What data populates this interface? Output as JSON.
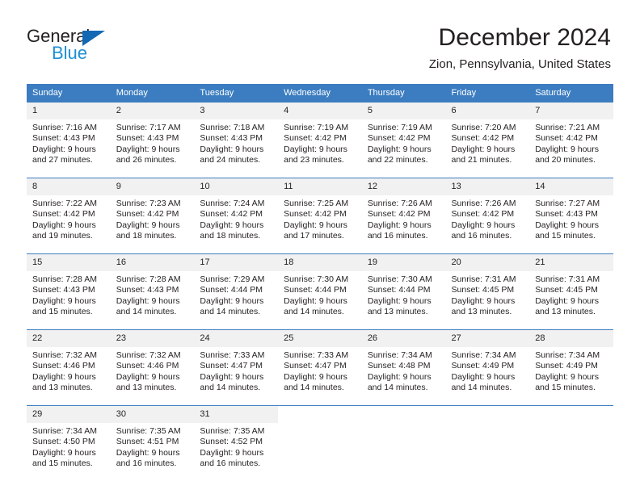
{
  "branding": {
    "name_part1": "General",
    "name_part2": "Blue",
    "color_dark": "#231f20",
    "color_blue": "#1d8fd4",
    "triangle_color": "#1368b3"
  },
  "header": {
    "title": "December 2024",
    "subtitle": "Zion, Pennsylvania, United States",
    "header_bg": "#3b7dc0",
    "header_text_color": "#ffffff",
    "daynum_bg": "#f1f1f1"
  },
  "weekdays": [
    "Sunday",
    "Monday",
    "Tuesday",
    "Wednesday",
    "Thursday",
    "Friday",
    "Saturday"
  ],
  "weeks": [
    [
      {
        "day": "1",
        "lines": [
          "Sunrise: 7:16 AM",
          "Sunset: 4:43 PM",
          "Daylight: 9 hours",
          "and 27 minutes."
        ]
      },
      {
        "day": "2",
        "lines": [
          "Sunrise: 7:17 AM",
          "Sunset: 4:43 PM",
          "Daylight: 9 hours",
          "and 26 minutes."
        ]
      },
      {
        "day": "3",
        "lines": [
          "Sunrise: 7:18 AM",
          "Sunset: 4:43 PM",
          "Daylight: 9 hours",
          "and 24 minutes."
        ]
      },
      {
        "day": "4",
        "lines": [
          "Sunrise: 7:19 AM",
          "Sunset: 4:42 PM",
          "Daylight: 9 hours",
          "and 23 minutes."
        ]
      },
      {
        "day": "5",
        "lines": [
          "Sunrise: 7:19 AM",
          "Sunset: 4:42 PM",
          "Daylight: 9 hours",
          "and 22 minutes."
        ]
      },
      {
        "day": "6",
        "lines": [
          "Sunrise: 7:20 AM",
          "Sunset: 4:42 PM",
          "Daylight: 9 hours",
          "and 21 minutes."
        ]
      },
      {
        "day": "7",
        "lines": [
          "Sunrise: 7:21 AM",
          "Sunset: 4:42 PM",
          "Daylight: 9 hours",
          "and 20 minutes."
        ]
      }
    ],
    [
      {
        "day": "8",
        "lines": [
          "Sunrise: 7:22 AM",
          "Sunset: 4:42 PM",
          "Daylight: 9 hours",
          "and 19 minutes."
        ]
      },
      {
        "day": "9",
        "lines": [
          "Sunrise: 7:23 AM",
          "Sunset: 4:42 PM",
          "Daylight: 9 hours",
          "and 18 minutes."
        ]
      },
      {
        "day": "10",
        "lines": [
          "Sunrise: 7:24 AM",
          "Sunset: 4:42 PM",
          "Daylight: 9 hours",
          "and 18 minutes."
        ]
      },
      {
        "day": "11",
        "lines": [
          "Sunrise: 7:25 AM",
          "Sunset: 4:42 PM",
          "Daylight: 9 hours",
          "and 17 minutes."
        ]
      },
      {
        "day": "12",
        "lines": [
          "Sunrise: 7:26 AM",
          "Sunset: 4:42 PM",
          "Daylight: 9 hours",
          "and 16 minutes."
        ]
      },
      {
        "day": "13",
        "lines": [
          "Sunrise: 7:26 AM",
          "Sunset: 4:42 PM",
          "Daylight: 9 hours",
          "and 16 minutes."
        ]
      },
      {
        "day": "14",
        "lines": [
          "Sunrise: 7:27 AM",
          "Sunset: 4:43 PM",
          "Daylight: 9 hours",
          "and 15 minutes."
        ]
      }
    ],
    [
      {
        "day": "15",
        "lines": [
          "Sunrise: 7:28 AM",
          "Sunset: 4:43 PM",
          "Daylight: 9 hours",
          "and 15 minutes."
        ]
      },
      {
        "day": "16",
        "lines": [
          "Sunrise: 7:28 AM",
          "Sunset: 4:43 PM",
          "Daylight: 9 hours",
          "and 14 minutes."
        ]
      },
      {
        "day": "17",
        "lines": [
          "Sunrise: 7:29 AM",
          "Sunset: 4:44 PM",
          "Daylight: 9 hours",
          "and 14 minutes."
        ]
      },
      {
        "day": "18",
        "lines": [
          "Sunrise: 7:30 AM",
          "Sunset: 4:44 PM",
          "Daylight: 9 hours",
          "and 14 minutes."
        ]
      },
      {
        "day": "19",
        "lines": [
          "Sunrise: 7:30 AM",
          "Sunset: 4:44 PM",
          "Daylight: 9 hours",
          "and 13 minutes."
        ]
      },
      {
        "day": "20",
        "lines": [
          "Sunrise: 7:31 AM",
          "Sunset: 4:45 PM",
          "Daylight: 9 hours",
          "and 13 minutes."
        ]
      },
      {
        "day": "21",
        "lines": [
          "Sunrise: 7:31 AM",
          "Sunset: 4:45 PM",
          "Daylight: 9 hours",
          "and 13 minutes."
        ]
      }
    ],
    [
      {
        "day": "22",
        "lines": [
          "Sunrise: 7:32 AM",
          "Sunset: 4:46 PM",
          "Daylight: 9 hours",
          "and 13 minutes."
        ]
      },
      {
        "day": "23",
        "lines": [
          "Sunrise: 7:32 AM",
          "Sunset: 4:46 PM",
          "Daylight: 9 hours",
          "and 13 minutes."
        ]
      },
      {
        "day": "24",
        "lines": [
          "Sunrise: 7:33 AM",
          "Sunset: 4:47 PM",
          "Daylight: 9 hours",
          "and 14 minutes."
        ]
      },
      {
        "day": "25",
        "lines": [
          "Sunrise: 7:33 AM",
          "Sunset: 4:47 PM",
          "Daylight: 9 hours",
          "and 14 minutes."
        ]
      },
      {
        "day": "26",
        "lines": [
          "Sunrise: 7:34 AM",
          "Sunset: 4:48 PM",
          "Daylight: 9 hours",
          "and 14 minutes."
        ]
      },
      {
        "day": "27",
        "lines": [
          "Sunrise: 7:34 AM",
          "Sunset: 4:49 PM",
          "Daylight: 9 hours",
          "and 14 minutes."
        ]
      },
      {
        "day": "28",
        "lines": [
          "Sunrise: 7:34 AM",
          "Sunset: 4:49 PM",
          "Daylight: 9 hours",
          "and 15 minutes."
        ]
      }
    ],
    [
      {
        "day": "29",
        "lines": [
          "Sunrise: 7:34 AM",
          "Sunset: 4:50 PM",
          "Daylight: 9 hours",
          "and 15 minutes."
        ]
      },
      {
        "day": "30",
        "lines": [
          "Sunrise: 7:35 AM",
          "Sunset: 4:51 PM",
          "Daylight: 9 hours",
          "and 16 minutes."
        ]
      },
      {
        "day": "31",
        "lines": [
          "Sunrise: 7:35 AM",
          "Sunset: 4:52 PM",
          "Daylight: 9 hours",
          "and 16 minutes."
        ]
      },
      {
        "day": "",
        "lines": []
      },
      {
        "day": "",
        "lines": []
      },
      {
        "day": "",
        "lines": []
      },
      {
        "day": "",
        "lines": []
      }
    ]
  ]
}
